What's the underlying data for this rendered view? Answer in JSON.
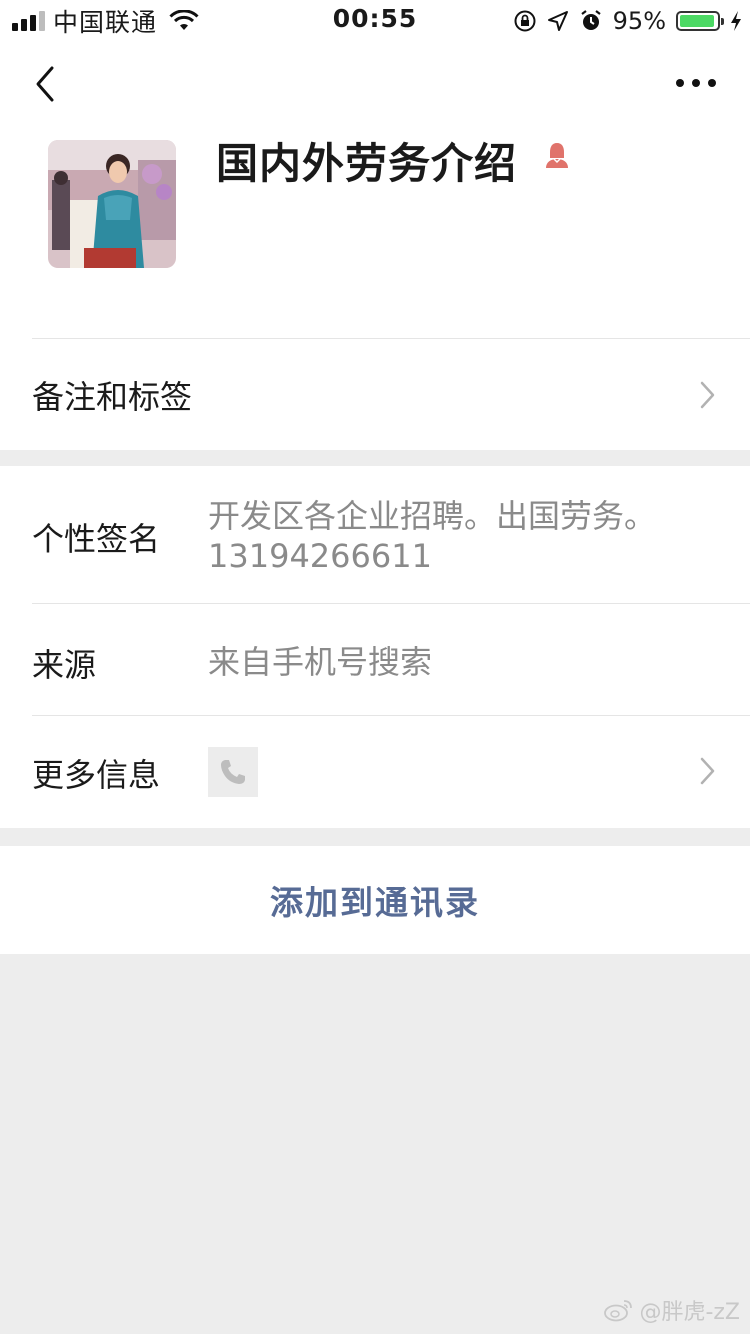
{
  "status_bar": {
    "carrier": "中国联通",
    "time": "00:55",
    "battery_percent": "95%",
    "battery_level": 0.95
  },
  "profile": {
    "display_name": "国内外劳务介绍",
    "gender": "female"
  },
  "rows": {
    "remarks_tags": {
      "label": "备注和标签"
    },
    "signature": {
      "label": "个性签名",
      "value_line1": "开发区各企业招聘。出国劳务。",
      "value_line2": "13194266611"
    },
    "source": {
      "label": "来源",
      "value": "来自手机号搜索"
    },
    "more_info": {
      "label": "更多信息"
    }
  },
  "actions": {
    "add_to_contacts": "添加到通讯录"
  },
  "watermark": {
    "text": "@胖虎-zZ"
  },
  "colors": {
    "link_blue": "#576b95",
    "gender_female": "#e0736b",
    "battery_green": "#4cd964",
    "page_bg": "#ededed"
  },
  "icons": [
    "back-arrow-icon",
    "more-dots-icon",
    "female-gender-icon",
    "chevron-right-icon",
    "phone-icon",
    "weibo-icon",
    "wifi-icon",
    "signal-icon",
    "lock-rotation-icon",
    "location-icon",
    "alarm-icon",
    "charging-icon"
  ]
}
